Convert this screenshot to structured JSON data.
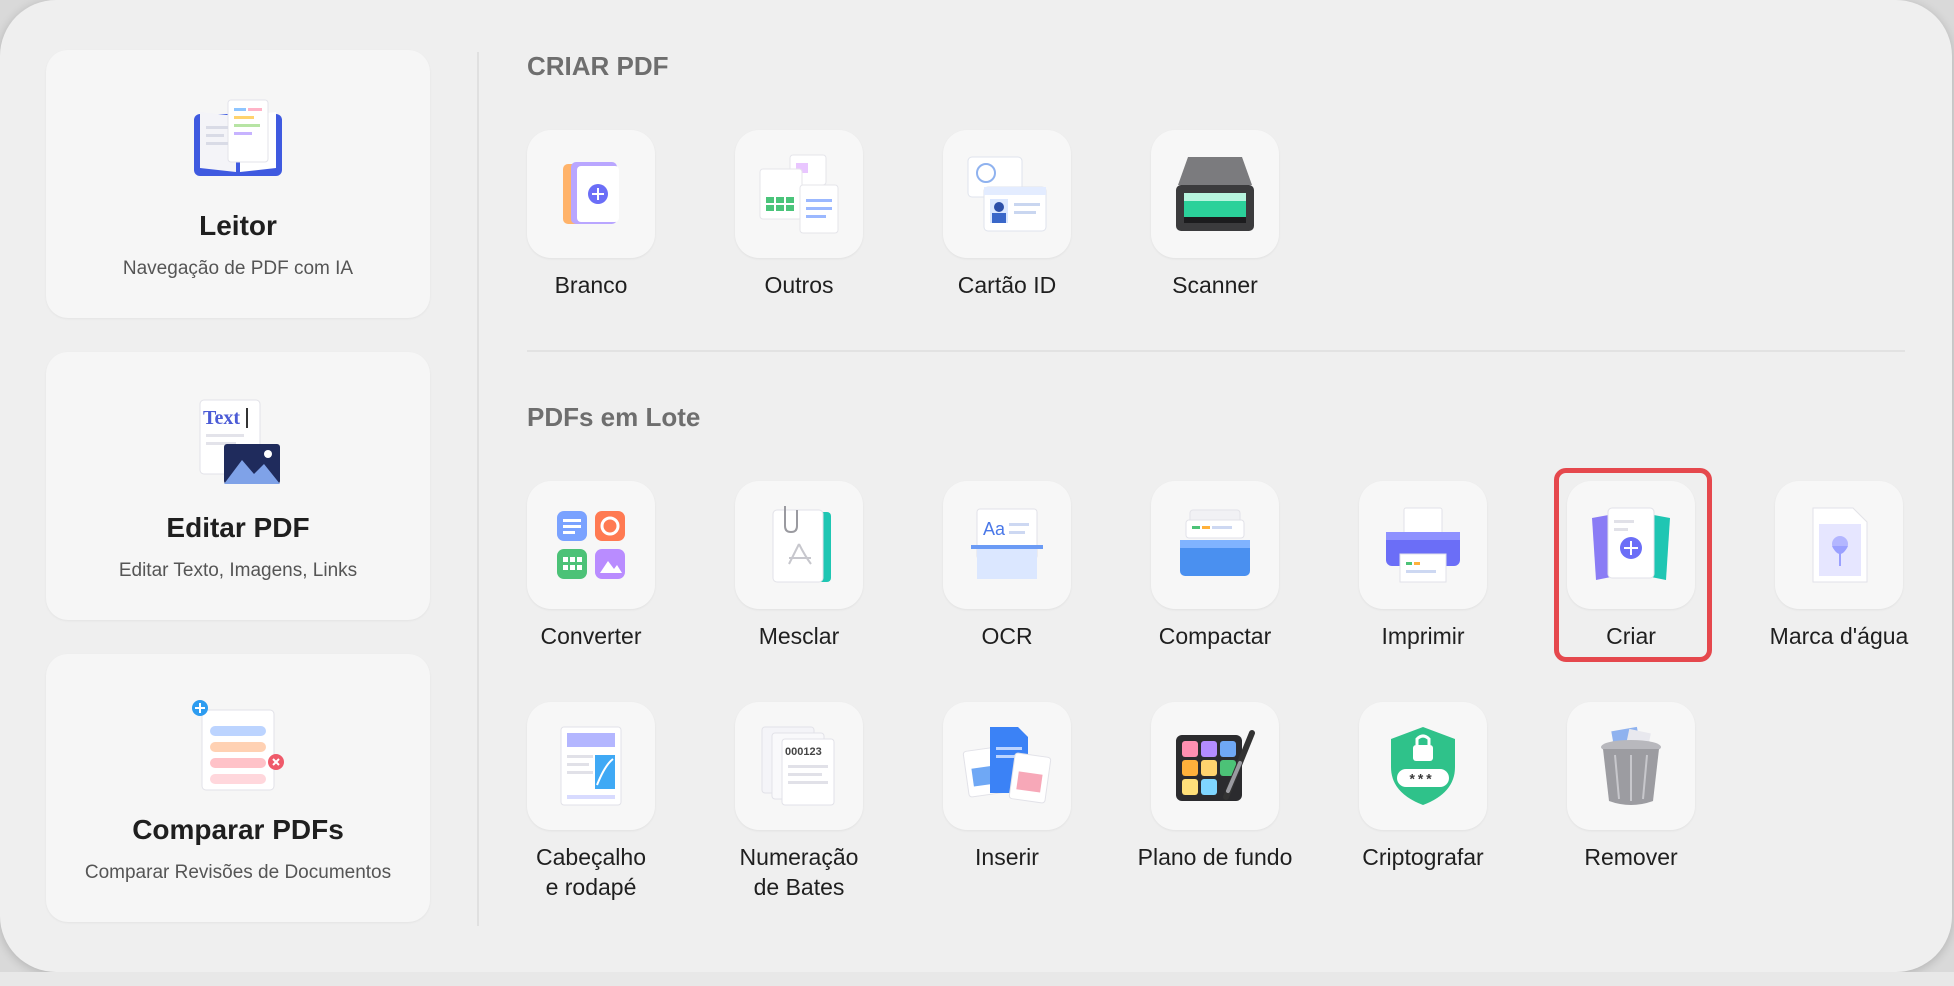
{
  "left_panel": [
    {
      "title": "Leitor",
      "subtitle": "Navegação de PDF com IA",
      "icon": "book-icon"
    },
    {
      "title": "Editar PDF",
      "subtitle": "Editar Texto, Imagens, Links",
      "icon": "edit-text-icon",
      "icon_text": "Text"
    },
    {
      "title": "Comparar PDFs",
      "subtitle": "Comparar Revisões de Documentos",
      "icon": "compare-icon"
    }
  ],
  "create_section": {
    "title": "CRIAR PDF",
    "items": [
      {
        "label": "Branco",
        "icon": "blank-page-icon"
      },
      {
        "label": "Outros",
        "icon": "other-files-icon"
      },
      {
        "label": "Cartão ID",
        "icon": "id-card-icon"
      },
      {
        "label": "Scanner",
        "icon": "scanner-icon"
      }
    ]
  },
  "batch_section": {
    "title": "PDFs em Lote",
    "row1": [
      {
        "label": "Converter",
        "icon": "convert-icon"
      },
      {
        "label": "Mesclar",
        "icon": "merge-icon"
      },
      {
        "label": "OCR",
        "icon": "ocr-icon"
      },
      {
        "label": "Compactar",
        "icon": "compress-icon"
      },
      {
        "label": "Imprimir",
        "icon": "printer-icon"
      },
      {
        "label": "Criar",
        "icon": "create-icon"
      },
      {
        "label": "Marca d'água",
        "icon": "watermark-icon"
      }
    ],
    "row2": [
      {
        "label": "Cabeçalho",
        "label2": "e rodapé",
        "icon": "header-footer-icon"
      },
      {
        "label": "Numeração",
        "label2": "de Bates",
        "icon": "bates-number-icon",
        "icon_text": "000123"
      },
      {
        "label": "Inserir",
        "icon": "insert-icon"
      },
      {
        "label": "Plano de fundo",
        "icon": "background-icon"
      },
      {
        "label": "Criptografar",
        "icon": "encrypt-icon",
        "icon_text": "***"
      },
      {
        "label": "Remover",
        "icon": "trash-icon"
      }
    ]
  },
  "colors": {
    "highlight": "#e5484d",
    "accent": "#5b6cf0"
  }
}
